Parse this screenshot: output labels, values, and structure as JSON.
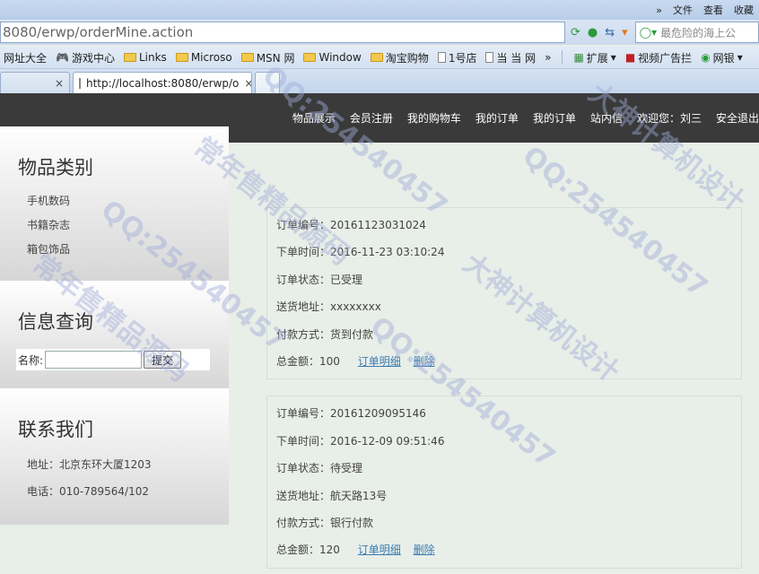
{
  "menubar": {
    "chevron": "»",
    "items": [
      "文件",
      "查看",
      "收藏"
    ]
  },
  "address": {
    "url": "8080/erwp/orderMine.action",
    "search_text": "最危险的海上公"
  },
  "favorites": [
    {
      "label": "网址大全",
      "icon": "page"
    },
    {
      "label": "游戏中心",
      "icon": "gamepad"
    },
    {
      "label": "Links",
      "icon": "folder"
    },
    {
      "label": "Microso",
      "icon": "folder"
    },
    {
      "label": "MSN 网",
      "icon": "folder"
    },
    {
      "label": "Window",
      "icon": "folder"
    },
    {
      "label": "淘宝购物",
      "icon": "folder"
    },
    {
      "label": "1号店",
      "icon": "page"
    },
    {
      "label": "当 当 网",
      "icon": "page"
    }
  ],
  "favorites_more": "»",
  "toolbar_right": [
    {
      "label": "扩展"
    },
    {
      "label": "视频广告拦"
    },
    {
      "label": "网银"
    }
  ],
  "tabs": [
    {
      "label": "",
      "close": "×"
    },
    {
      "label": "http://localhost:8080/erwp/o",
      "close": "×"
    }
  ],
  "nav": [
    "物品展示",
    "会员注册",
    "我的购物车",
    "我的订单",
    "我的订单",
    "站内信",
    "欢迎您：刘三",
    "安全退出"
  ],
  "sidebar": {
    "category_title": "物品类别",
    "categories": [
      "手机数码",
      "书籍杂志",
      "箱包饰品"
    ],
    "query_title": "信息查询",
    "query_label": "名称:",
    "query_submit": "提交",
    "contact_title": "联系我们",
    "address": "地址：北京东环大厦1203",
    "phone": "电话：010-789564/102"
  },
  "orders": [
    {
      "number": "订单编号：20161123031024",
      "time": "下单时间：2016-11-23 03:10:24",
      "status": "订单状态：已受理",
      "address": "送货地址：xxxxxxxx",
      "payment": "付款方式：货到付款",
      "total": "总金额：100",
      "detail_link": "订单明细",
      "delete_link": "删除"
    },
    {
      "number": "订单编号：20161209095146",
      "time": "下单时间：2016-12-09 09:51:46",
      "status": "订单状态：待受理",
      "address": "送货地址：航天路13号",
      "payment": "付款方式：银行付款",
      "total": "总金额：120",
      "detail_link": "订单明细",
      "delete_link": "删除"
    }
  ],
  "watermark": {
    "qq": "QQ:254540457",
    "brand": "大神计算机设计",
    "src": "常年售精品源码"
  }
}
